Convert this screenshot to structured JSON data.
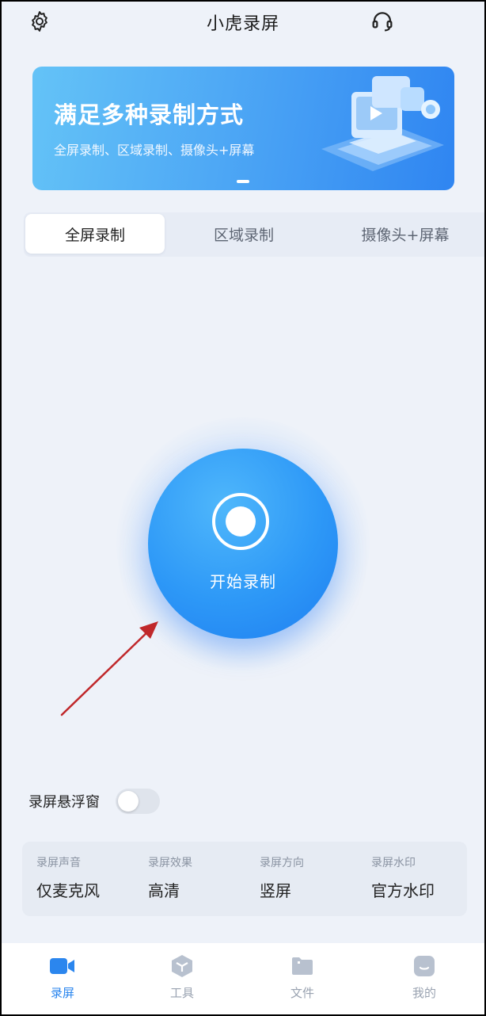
{
  "app": {
    "title": "小虎录屏",
    "header_icons": [
      "gear-icon",
      "headset-icon"
    ]
  },
  "banner": {
    "headline": "满足多种录制方式",
    "subline": "全屏录制、区域录制、摄像头+屏幕"
  },
  "tabs": [
    {
      "label": "全屏录制",
      "active": true
    },
    {
      "label": "区域录制",
      "active": false
    },
    {
      "label": "摄像头+屏幕",
      "active": false
    }
  ],
  "record": {
    "label": "开始录制"
  },
  "floating_window": {
    "label": "录屏悬浮窗",
    "enabled": false
  },
  "settings": [
    {
      "label": "录屏声音",
      "value": "仅麦克风"
    },
    {
      "label": "录屏效果",
      "value": "高清"
    },
    {
      "label": "录屏方向",
      "value": "竖屏"
    },
    {
      "label": "录屏水印",
      "value": "官方水印"
    }
  ],
  "nav": [
    {
      "label": "录屏",
      "icon": "video-camera-icon",
      "active": true
    },
    {
      "label": "工具",
      "icon": "cube-icon",
      "active": false
    },
    {
      "label": "文件",
      "icon": "folder-icon",
      "active": false
    },
    {
      "label": "我的",
      "icon": "profile-icon",
      "active": false
    }
  ],
  "colors": {
    "accent": "#2b86ee",
    "background": "#eef2f9",
    "annotation_arrow": "#c0282b"
  }
}
